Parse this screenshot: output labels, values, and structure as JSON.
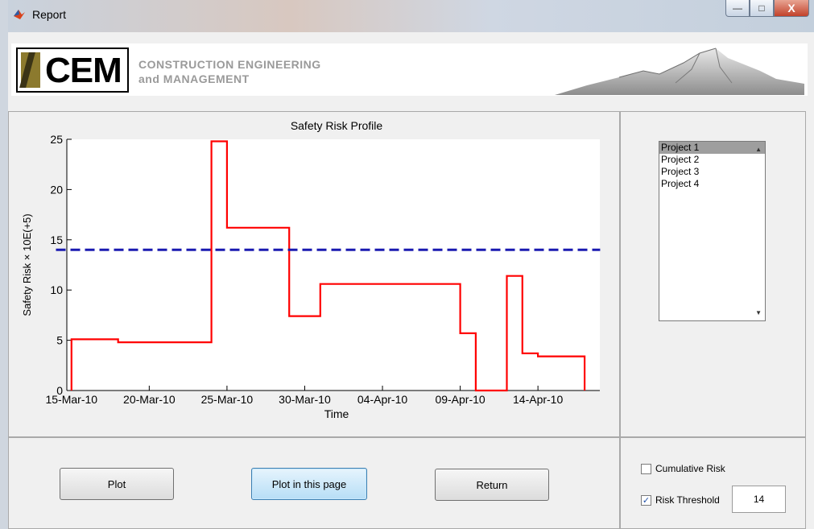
{
  "window": {
    "title": "Report",
    "buttons": {
      "minimize": "—",
      "maximize": "□",
      "close": "X"
    }
  },
  "banner": {
    "logo_text": "CEM",
    "line1": "CONSTRUCTION ENGINEERING",
    "line2": "and MANAGEMENT"
  },
  "chart_data": {
    "type": "line",
    "title": "Safety Risk Profile",
    "xlabel": "Time",
    "ylabel": "Safety Risk × 10E(+5)",
    "ylim": [
      0,
      25
    ],
    "yticks": [
      0,
      5,
      10,
      15,
      20,
      25
    ],
    "xticks": [
      "15-Mar-10",
      "20-Mar-10",
      "25-Mar-10",
      "30-Mar-10",
      "04-Apr-10",
      "09-Apr-10",
      "14-Apr-10"
    ],
    "grid": false,
    "series": [
      {
        "color": "#ff0000",
        "style": "solid-step",
        "points": [
          [
            "15-Mar-10",
            0
          ],
          [
            "15-Mar-10",
            5.1
          ],
          [
            "18-Mar-10",
            5.1
          ],
          [
            "18-Mar-10",
            4.8
          ],
          [
            "24-Mar-10",
            4.8
          ],
          [
            "24-Mar-10",
            24.8
          ],
          [
            "25-Mar-10",
            24.8
          ],
          [
            "25-Mar-10",
            16.2
          ],
          [
            "29-Mar-10",
            16.2
          ],
          [
            "29-Mar-10",
            7.4
          ],
          [
            "31-Mar-10",
            7.4
          ],
          [
            "31-Mar-10",
            10.6
          ],
          [
            "09-Apr-10",
            10.6
          ],
          [
            "09-Apr-10",
            5.7
          ],
          [
            "10-Apr-10",
            5.7
          ],
          [
            "10-Apr-10",
            0
          ],
          [
            "12-Apr-10",
            0
          ],
          [
            "12-Apr-10",
            11.4
          ],
          [
            "13-Apr-10",
            11.4
          ],
          [
            "13-Apr-10",
            3.7
          ],
          [
            "14-Apr-10",
            3.7
          ],
          [
            "14-Apr-10",
            3.4
          ],
          [
            "17-Apr-10",
            3.4
          ],
          [
            "17-Apr-10",
            0
          ]
        ]
      },
      {
        "color": "#1a1ab0",
        "style": "dashed",
        "points": [
          [
            "14-Mar-10",
            14
          ],
          [
            "18-Apr-10",
            14
          ]
        ]
      }
    ]
  },
  "projects": {
    "items": [
      "Project 1",
      "Project 2",
      "Project 3",
      "Project 4"
    ],
    "selected": "Project 1"
  },
  "buttons": {
    "plot": "Plot",
    "plot_in_page": "Plot in this page",
    "return": "Return"
  },
  "options": {
    "cumulative_risk": {
      "label": "Cumulative Risk",
      "checked": false
    },
    "risk_threshold": {
      "label": "Risk Threshold",
      "checked": true,
      "value": "14"
    }
  },
  "colors": {
    "risk_line": "#ff0000",
    "threshold_line": "#1a1ab0"
  }
}
